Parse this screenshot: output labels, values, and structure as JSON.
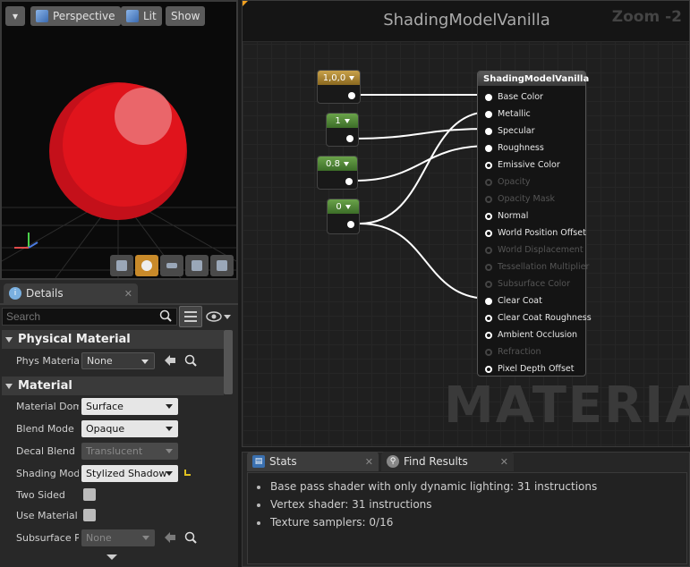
{
  "viewport": {
    "menu_label": "▾",
    "perspective_label": "Perspective",
    "lit_label": "Lit",
    "show_label": "Show"
  },
  "details": {
    "tab_label": "Details",
    "tab_close": "✕",
    "search_placeholder": "Search",
    "categories": {
      "physical": "Physical Material",
      "material": "Material"
    },
    "rows": {
      "phys_material": {
        "label": "Phys Materia",
        "value": "None"
      },
      "material_domain": {
        "label": "Material Dom",
        "value": "Surface"
      },
      "blend_mode": {
        "label": "Blend Mode",
        "value": "Opaque"
      },
      "decal_blend": {
        "label": "Decal Blend M",
        "value": "Translucent"
      },
      "shading_model": {
        "label": "Shading Mode",
        "value": "Stylized Shadow"
      },
      "two_sided": {
        "label": "Two Sided"
      },
      "use_material": {
        "label": "Use Material"
      },
      "subsurface": {
        "label": "Subsurface P",
        "value": "None"
      }
    }
  },
  "graph": {
    "title": "ShadingModelVanilla",
    "zoom": "Zoom -2",
    "watermark": "MATERIAL",
    "constants": [
      "1,0,0",
      "1",
      "0.8",
      "0"
    ],
    "node_title": "ShadingModelVanilla",
    "inputs": [
      {
        "label": "Base Color",
        "state": "connected"
      },
      {
        "label": "Metallic",
        "state": "connected"
      },
      {
        "label": "Specular",
        "state": "connected"
      },
      {
        "label": "Roughness",
        "state": "connected"
      },
      {
        "label": "Emissive Color",
        "state": "open"
      },
      {
        "label": "Opacity",
        "state": "disabled"
      },
      {
        "label": "Opacity Mask",
        "state": "disabled"
      },
      {
        "label": "Normal",
        "state": "open"
      },
      {
        "label": "World Position Offset",
        "state": "open"
      },
      {
        "label": "World Displacement",
        "state": "disabled"
      },
      {
        "label": "Tessellation Multiplier",
        "state": "disabled"
      },
      {
        "label": "Subsurface Color",
        "state": "disabled"
      },
      {
        "label": "Clear Coat",
        "state": "connected"
      },
      {
        "label": "Clear Coat Roughness",
        "state": "open"
      },
      {
        "label": "Ambient Occlusion",
        "state": "open"
      },
      {
        "label": "Refraction",
        "state": "disabled"
      },
      {
        "label": "Pixel Depth Offset",
        "state": "open"
      }
    ]
  },
  "stats_panel": {
    "tabs": {
      "stats": "Stats",
      "find_results": "Find Results",
      "close": "✕"
    },
    "lines": [
      "Base pass shader with only dynamic lighting: 31 instructions",
      "Vertex shader: 31 instructions",
      "Texture samplers: 0/16"
    ]
  },
  "colors": {
    "sphere": "#e0141c",
    "constant_header_green": "#5a9a3c",
    "constant_header_gold": "#b8902f",
    "selected_tool": "#c88a2a"
  }
}
